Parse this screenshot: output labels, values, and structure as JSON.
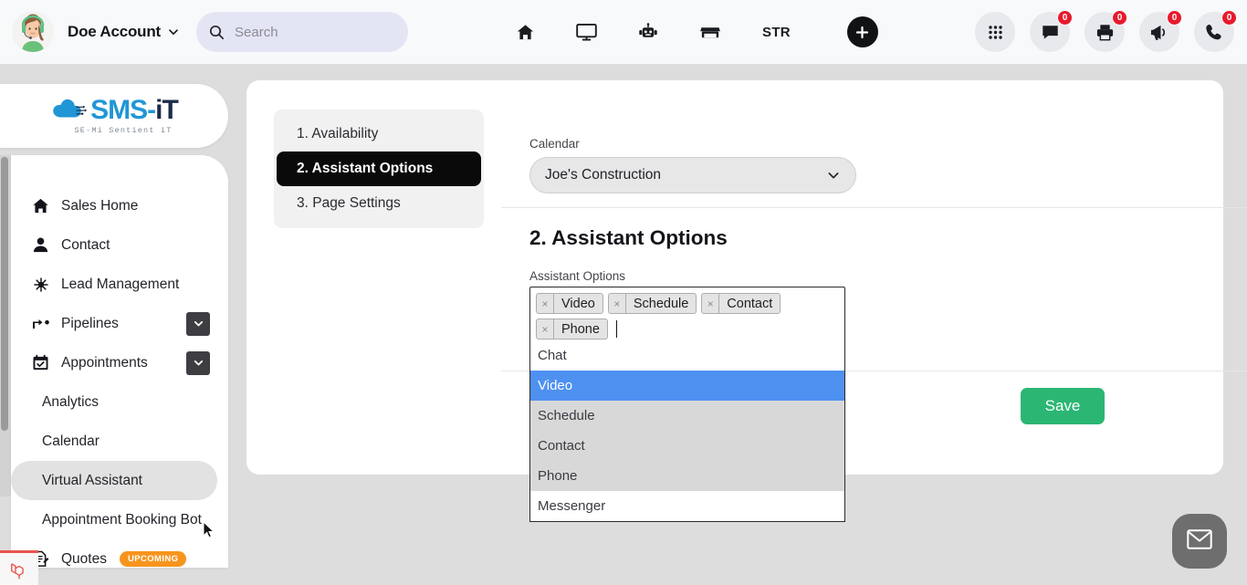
{
  "topbar": {
    "account_name": "Doe Account",
    "account_caret_icon": "chevron-down-icon",
    "avatar_icon": "user-avatar-headset",
    "search": {
      "placeholder": "Search",
      "value": "",
      "icon": "search-icon"
    },
    "nav_items": [
      {
        "name": "home",
        "icon": "home-icon",
        "label": ""
      },
      {
        "name": "monitor",
        "icon": "monitor-icon",
        "label": ""
      },
      {
        "name": "robot",
        "icon": "robot-icon",
        "label": ""
      },
      {
        "name": "store",
        "icon": "store-icon",
        "label": ""
      },
      {
        "name": "str",
        "icon": "",
        "label": "STR"
      }
    ],
    "add_button": {
      "icon": "plus-icon",
      "label": ""
    },
    "right_icons": [
      {
        "name": "apps-grid",
        "icon": "grid-icon",
        "badge": ""
      },
      {
        "name": "messages",
        "icon": "chat-icon",
        "badge": "0"
      },
      {
        "name": "print",
        "icon": "printer-icon",
        "badge": "0"
      },
      {
        "name": "announcements",
        "icon": "megaphone-icon",
        "badge": "0"
      },
      {
        "name": "calls",
        "icon": "phone-icon",
        "badge": "0"
      }
    ]
  },
  "logo": {
    "text_sms": "SMS",
    "text_dash": "-",
    "text_it": "iT",
    "tagline": "SE-Mi Sentient iT"
  },
  "sidebar": {
    "items": [
      {
        "label": "Sales Home",
        "icon": "home-icon",
        "type": "item",
        "active": false,
        "toggle": false,
        "badge": ""
      },
      {
        "label": "Contact",
        "icon": "user-icon",
        "type": "item",
        "active": false,
        "toggle": false,
        "badge": ""
      },
      {
        "label": "Lead Management",
        "icon": "lead-icon",
        "type": "item",
        "active": false,
        "toggle": false,
        "badge": ""
      },
      {
        "label": "Pipelines",
        "icon": "pipeline-icon",
        "type": "item",
        "active": false,
        "toggle": true,
        "badge": ""
      },
      {
        "label": "Appointments",
        "icon": "calendar-check-icon",
        "type": "item",
        "active": false,
        "toggle": true,
        "badge": ""
      },
      {
        "label": "Analytics",
        "icon": "",
        "type": "sub",
        "active": false,
        "toggle": false,
        "badge": ""
      },
      {
        "label": "Calendar",
        "icon": "",
        "type": "sub",
        "active": false,
        "toggle": false,
        "badge": ""
      },
      {
        "label": "Virtual Assistant",
        "icon": "",
        "type": "sub",
        "active": true,
        "toggle": false,
        "badge": ""
      },
      {
        "label": "Appointment Booking Bot",
        "icon": "",
        "type": "sub",
        "active": false,
        "toggle": false,
        "badge": ""
      },
      {
        "label": "Quotes",
        "icon": "quotes-icon",
        "type": "item",
        "active": false,
        "toggle": false,
        "badge": "UPCOMING"
      }
    ]
  },
  "main": {
    "steps": [
      {
        "label": "1. Availability",
        "active": false
      },
      {
        "label": "2. Assistant Options",
        "active": true
      },
      {
        "label": "3. Page Settings",
        "active": false
      }
    ],
    "calendar": {
      "label": "Calendar",
      "selected": "Joe's Construction",
      "caret_icon": "chevron-down-icon"
    },
    "section_title": "2. Assistant Options",
    "assistant_options": {
      "label": "Assistant Options",
      "tags": [
        {
          "label": "Video",
          "remove_icon": "close-icon"
        },
        {
          "label": "Schedule",
          "remove_icon": "close-icon"
        },
        {
          "label": "Contact",
          "remove_icon": "close-icon"
        },
        {
          "label": "Phone",
          "remove_icon": "close-icon"
        }
      ],
      "dropdown_options": [
        {
          "label": "Chat",
          "state": "plain"
        },
        {
          "label": "Video",
          "state": "highlight"
        },
        {
          "label": "Schedule",
          "state": "selected"
        },
        {
          "label": "Contact",
          "state": "selected"
        },
        {
          "label": "Phone",
          "state": "selected"
        },
        {
          "label": "Messenger",
          "state": "plain"
        }
      ]
    },
    "save_label": "Save"
  },
  "chat_widget": {
    "icon": "envelope-icon",
    "label": ""
  },
  "colors": {
    "accent_blue": "#4e91f0",
    "save_green": "#2bb673",
    "badge_red": "#e8192c",
    "upcoming_orange": "#f7941d",
    "active_black": "#0a0a0a",
    "logo_blue": "#2196d6"
  }
}
